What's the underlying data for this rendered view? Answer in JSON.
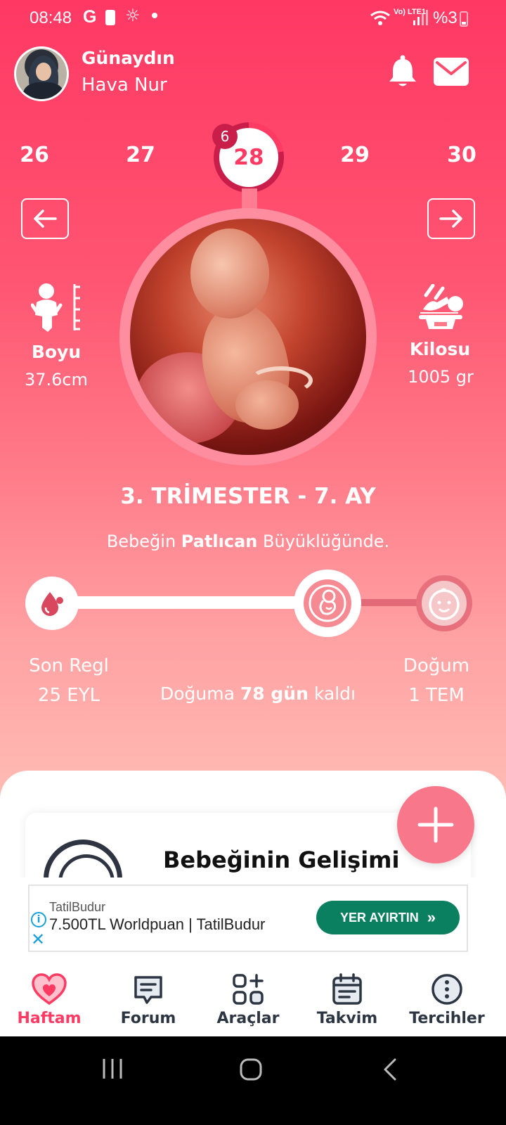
{
  "status_bar": {
    "time": "08:48",
    "g_label": "G",
    "network_label": "Vo) LTE1",
    "battery": "%3"
  },
  "header": {
    "greeting": "Günaydın",
    "username": "Hava Nur"
  },
  "weeks": {
    "items": [
      "26",
      "27",
      "28",
      "29",
      "30"
    ],
    "current": "28",
    "current_day_badge": "6"
  },
  "metrics": {
    "length_title": "Boyu",
    "length_value": "37.6cm",
    "weight_title": "Kilosu",
    "weight_value": "1005 gr"
  },
  "pregnancy": {
    "trimester": "3. TRİMESTER - 7. AY",
    "size_prefix": "Bebeğin",
    "size_fruit": "Patlıcan",
    "size_suffix": "Büyüklüğünde."
  },
  "progress": {
    "start_label": "Son Regl",
    "start_date": "25 EYL",
    "end_label": "Doğum",
    "end_date": "1 TEM",
    "countdown_prefix": "Doğuma",
    "countdown_value": "78 gün",
    "countdown_suffix": "kaldı"
  },
  "card": {
    "title": "Bebeğinin Gelişimi"
  },
  "ad": {
    "brand": "TatilBudur",
    "headline": "7.500TL Worldpuan | TatilBudur",
    "cta": "YER AYIRTIN",
    "cta_color": "#0a8060"
  },
  "bottom_nav": {
    "items": [
      {
        "label": "Haftam",
        "icon": "heart-icon",
        "active": true
      },
      {
        "label": "Forum",
        "icon": "chat-icon",
        "active": false
      },
      {
        "label": "Araçlar",
        "icon": "tools-grid-icon",
        "active": false
      },
      {
        "label": "Takvim",
        "icon": "calendar-icon",
        "active": false
      },
      {
        "label": "Tercihler",
        "icon": "more-icon",
        "active": false
      }
    ]
  },
  "colors": {
    "accent": "#ff3a63",
    "accent_dark": "#c91e4a",
    "fab": "#f8778a",
    "nav_text": "#2c3542"
  }
}
